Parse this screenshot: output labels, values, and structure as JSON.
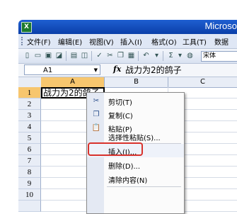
{
  "window": {
    "app_title": "Microso",
    "app_icon": "X"
  },
  "menu": {
    "items": [
      "文件(F)",
      "编辑(E)",
      "视图(V)",
      "插入(I)",
      "格式(O)",
      "工具(T)",
      "数据"
    ]
  },
  "toolbar": {
    "icons": [
      "new-icon",
      "open-icon",
      "save-icon",
      "permission-icon",
      "print-icon",
      "print-preview-icon",
      "spelling-icon",
      "cut-icon",
      "copy-icon",
      "paste-icon",
      "undo-icon",
      "autosum-icon",
      "sort-icon",
      "help-icon"
    ],
    "font_name": "宋体"
  },
  "formula_bar": {
    "name_box": "A1",
    "fx_label": "fx",
    "content": "战力为2的鸽子"
  },
  "columns": [
    "A",
    "B",
    "C"
  ],
  "rows": [
    "1",
    "2",
    "3",
    "4",
    "5",
    "6",
    "7",
    "8",
    "9",
    "10"
  ],
  "cells": {
    "A1": "战力为2的鸽子"
  },
  "context_menu": {
    "items": [
      {
        "label": "剪切(T)",
        "icon": "scissors-icon",
        "glyph": "✂"
      },
      {
        "label": "复制(C)",
        "icon": "copy-icon",
        "glyph": "❐"
      },
      {
        "label": "粘贴(P)",
        "icon": "paste-icon",
        "glyph": "📋"
      },
      {
        "label": "选择性粘贴(S)...",
        "icon": "",
        "glyph": ""
      },
      {
        "label": "插入(I)...",
        "icon": "",
        "glyph": ""
      },
      {
        "label": "删除(D)...",
        "icon": "",
        "glyph": ""
      },
      {
        "label": "清除内容(N)",
        "icon": "",
        "glyph": ""
      }
    ],
    "highlighted_item": "插入(I)...",
    "highlight_color": "#d8322c"
  },
  "colors": {
    "title_bar": "#0a3fa9",
    "menu_bar": "#dfe7f5",
    "active_header": "#f7c66e"
  }
}
